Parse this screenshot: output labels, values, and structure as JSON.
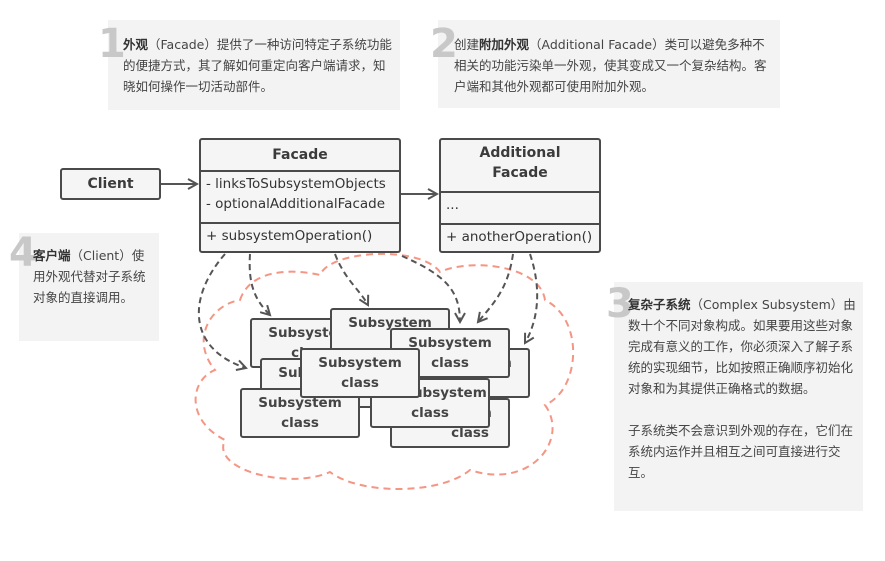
{
  "notes": [
    {
      "num": "1",
      "bold": "外观",
      "text": "（Facade）提供了一种访问特定子系统功能的便捷方式，其了解如何重定向客户端请求，知晓如何操作一切活动部件。"
    },
    {
      "num": "2",
      "pre": "创建",
      "bold": "附加外观",
      "text": "（Additional Facade）类可以避免多种不相关的功能污染单一外观，使其变成又一个复杂结构。客户端和其他外观都可使用附加外观。"
    },
    {
      "num": "3",
      "bold": "复杂子系统",
      "text": "（Complex Subsystem）由数十个不同对象构成。如果要用这些对象完成有意义的工作，你必须深入了解子系统的实现细节，比如按照正确顺序初始化对象和为其提供正确格式的数据。",
      "text2": "子系统类不会意识到外观的存在，它们在系统内运作并且相互之间可直接进行交互。"
    },
    {
      "num": "4",
      "bold": "客户端",
      "text": "（Client）使用外观代替对子系统对象的直接调用。"
    }
  ],
  "client": {
    "title": "Client"
  },
  "facade": {
    "title": "Facade",
    "fields": [
      "- linksToSubsystemObjects",
      "- optionalAdditionalFacade"
    ],
    "methods": [
      "+ subsystemOperation()"
    ]
  },
  "additional": {
    "title": "Additional Facade",
    "fields": [
      "..."
    ],
    "methods": [
      "+ anotherOperation()"
    ]
  },
  "subsystem": {
    "label1": "Subsystem",
    "label2": "class"
  },
  "colors": {
    "cloud": "#f59583",
    "line": "#4a4a4a",
    "note_bg": "#f3f3f3"
  }
}
